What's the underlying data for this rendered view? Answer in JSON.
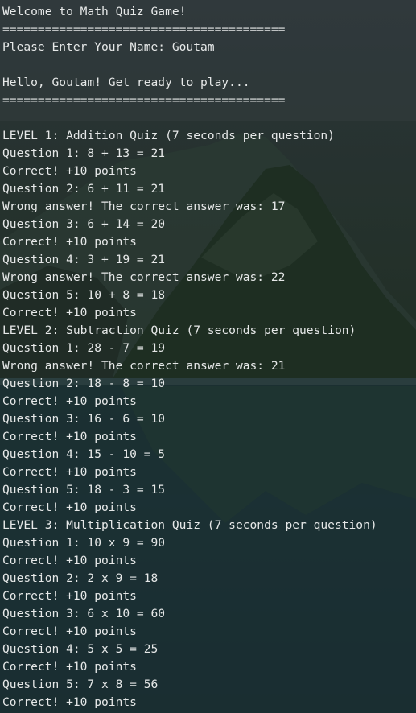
{
  "terminal": {
    "lines": [
      "Welcome to Math Quiz Game!",
      "========================================",
      "Please Enter Your Name: Goutam",
      "",
      "Hello, Goutam! Get ready to play...",
      "========================================",
      "",
      "LEVEL 1: Addition Quiz (7 seconds per question)",
      "Question 1: 8 + 13 = 21",
      "Correct! +10 points",
      "Question 2: 6 + 11 = 21",
      "Wrong answer! The correct answer was: 17",
      "Question 3: 6 + 14 = 20",
      "Correct! +10 points",
      "Question 4: 3 + 19 = 21",
      "Wrong answer! The correct answer was: 22",
      "Question 5: 10 + 8 = 18",
      "Correct! +10 points",
      "LEVEL 2: Subtraction Quiz (7 seconds per question)",
      "Question 1: 28 - 7 = 19",
      "Wrong answer! The correct answer was: 21",
      "Question 2: 18 - 8 = 10",
      "Correct! +10 points",
      "Question 3: 16 - 6 = 10",
      "Correct! +10 points",
      "Question 4: 15 - 10 = 5",
      "Correct! +10 points",
      "Question 5: 18 - 3 = 15",
      "Correct! +10 points",
      "LEVEL 3: Multiplication Quiz (7 seconds per question)",
      "Question 1: 10 x 9 = 90",
      "Correct! +10 points",
      "Question 2: 2 x 9 = 18",
      "Correct! +10 points",
      "Question 3: 6 x 10 = 60",
      "Correct! +10 points",
      "Question 4: 5 x 5 = 25",
      "Correct! +10 points",
      "Question 5: 7 x 8 = 56",
      "Correct! +10 points"
    ]
  },
  "colors": {
    "text": "#e6e8e8",
    "background": "#1f2b2d"
  }
}
